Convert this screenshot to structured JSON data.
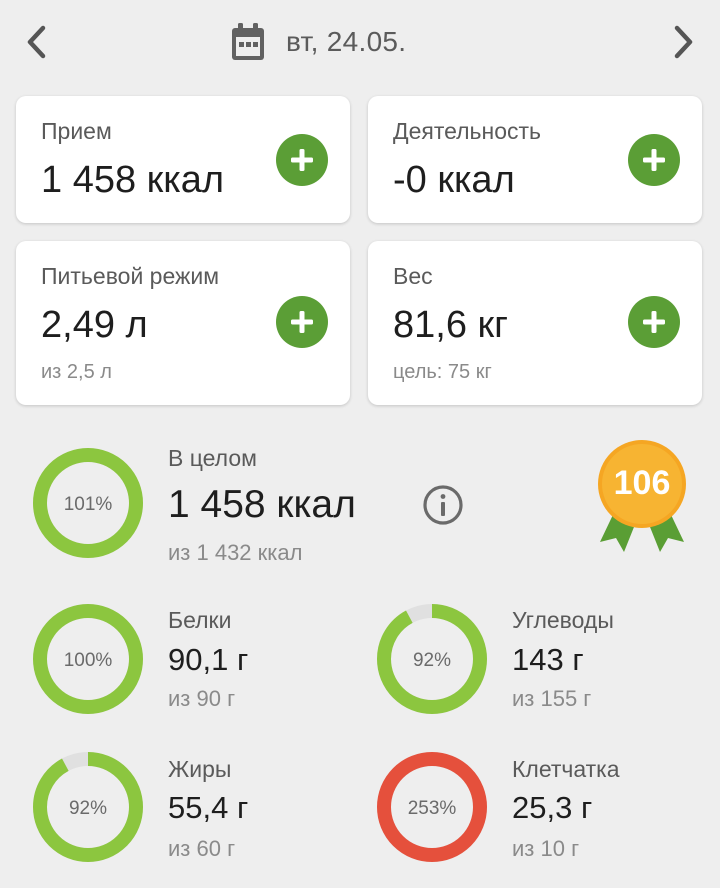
{
  "header": {
    "date": "вт, 24.05."
  },
  "cards": {
    "intake": {
      "label": "Прием",
      "value": "1 458 ккал"
    },
    "activity": {
      "label": "Деятельность",
      "value": "-0 ккал"
    },
    "water": {
      "label": "Питьевой режим",
      "value": "2,49 л",
      "sub": "из 2,5 л"
    },
    "weight": {
      "label": "Вес",
      "value": "81,6 кг",
      "sub": "цель: 75 кг"
    }
  },
  "summary": {
    "label": "В целом",
    "value": "1 458 ккал",
    "sub": "из 1 432 ккал",
    "percent_text": "101%",
    "percent": 101,
    "badge": "106"
  },
  "macros": {
    "protein": {
      "label": "Белки",
      "value": "90,1 г",
      "sub": "из 90 г",
      "percent_text": "100%",
      "percent": 100
    },
    "carbs": {
      "label": "Углеводы",
      "value": "143 г",
      "sub": "из 155 г",
      "percent_text": "92%",
      "percent": 92
    },
    "fat": {
      "label": "Жиры",
      "value": "55,4 г",
      "sub": "из 60 г",
      "percent_text": "92%",
      "percent": 92
    },
    "fiber": {
      "label": "Клетчатка",
      "value": "25,3 г",
      "sub": "из 10 г",
      "percent_text": "253%",
      "percent": 253
    }
  },
  "colors": {
    "accent_green": "#5b9e36",
    "ring_green": "#8cc63f",
    "ring_red": "#e5503c",
    "ring_track": "#e0e0e0",
    "badge_orange": "#f5a623"
  }
}
